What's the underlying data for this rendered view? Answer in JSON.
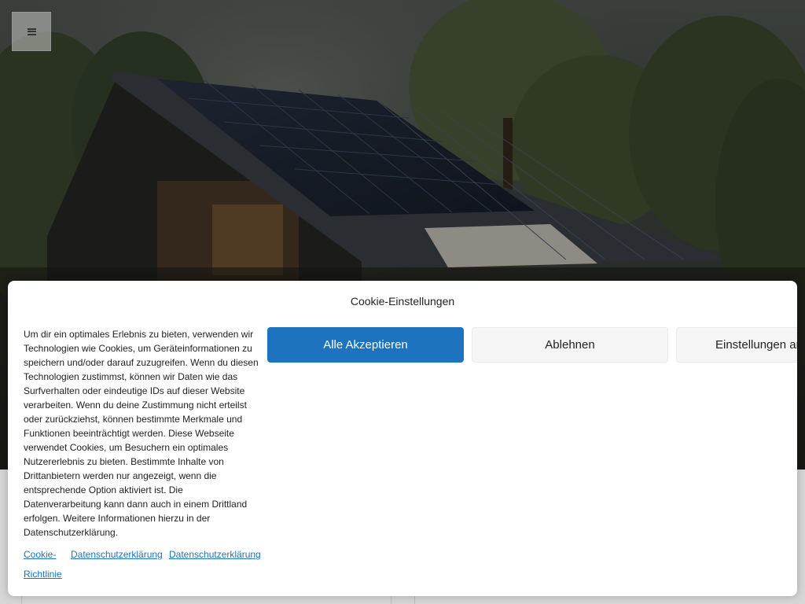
{
  "menu": {
    "icon": "hamburger-icon"
  },
  "cookie": {
    "title": "Cookie-Einstellungen",
    "text": "Um dir ein optimales Erlebnis zu bieten, verwenden wir Technologien wie Cookies, um Geräteinformationen zu speichern und/oder darauf zuzugreifen. Wenn du diesen Technologien zustimmst, können wir Daten wie das Surfverhalten oder eindeutige IDs auf dieser Website verarbeiten. Wenn du deine Zustimmung nicht erteilst oder zurückziehst, können bestimmte Merkmale und Funktionen beeinträchtigt werden. Diese Webseite verwendet Cookies, um Besuchern ein optimales Nutzererlebnis zu bieten. Bestimmte Inhalte von Drittanbietern werden nur angezeigt, wenn die entsprechende Option aktiviert ist. Die Datenverarbeitung kann dann auch in einem Drittland erfolgen. Weitere Informationen hierzu in der Datenschutzerklärung.",
    "buttons": {
      "accept": "Alle Akzeptieren",
      "deny": "Ablehnen",
      "settings": "Einstellungen ansehen"
    },
    "links": {
      "cookie_policy_line1": "Cookie-",
      "cookie_policy_line2": "Richtlinie",
      "privacy_1": "Datenschutzerklärung",
      "privacy_2": "Datenschutzerklärung"
    }
  },
  "colors": {
    "accent": "#1e73be",
    "button_secondary": "#f5f5f5",
    "banner_bg": "#ffffff"
  }
}
